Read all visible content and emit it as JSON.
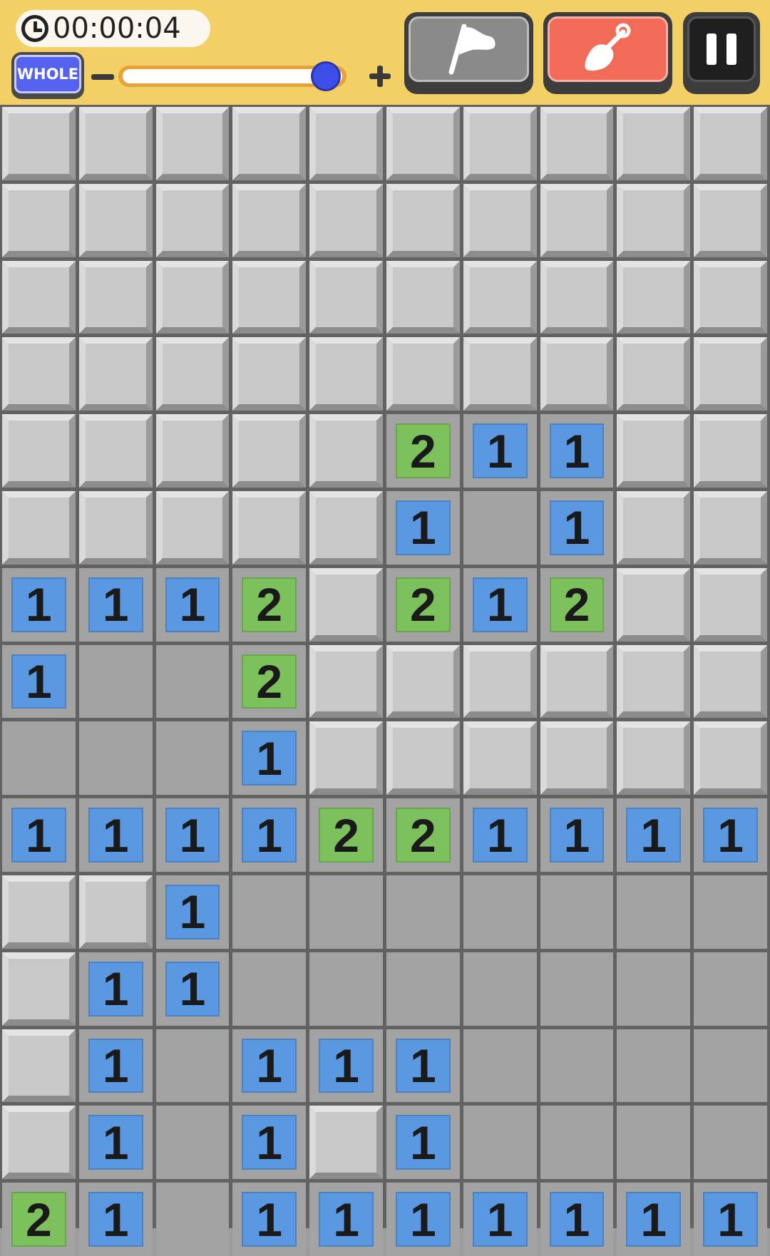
{
  "header": {
    "timer": "00:00:04",
    "zoom_mode_label": "WHOLE",
    "zoom_level": 1.0,
    "tools": {
      "flag": "flag-icon",
      "dig": "shovel-icon",
      "pause": "pause-icon"
    },
    "active_tool": "dig"
  },
  "colors": {
    "header_bg": "#f2d066",
    "one_tile": "#5b98e2",
    "two_tile": "#7cc15c",
    "dig_button": "#f26a58",
    "zoom_mode_button": "#5562f0"
  },
  "board": {
    "columns": 10,
    "legend": "C = covered, R = revealed empty, digits = revealed number",
    "rows": [
      [
        "C",
        "C",
        "C",
        "C",
        "C",
        "C",
        "C",
        "C",
        "C",
        "C"
      ],
      [
        "C",
        "C",
        "C",
        "C",
        "C",
        "C",
        "C",
        "C",
        "C",
        "C"
      ],
      [
        "C",
        "C",
        "C",
        "C",
        "C",
        "C",
        "C",
        "C",
        "C",
        "C"
      ],
      [
        "C",
        "C",
        "C",
        "C",
        "C",
        "C",
        "C",
        "C",
        "C",
        "C"
      ],
      [
        "C",
        "C",
        "C",
        "C",
        "C",
        "2",
        "1",
        "1",
        "C",
        "C"
      ],
      [
        "C",
        "C",
        "C",
        "C",
        "C",
        "1",
        "R",
        "1",
        "C",
        "C"
      ],
      [
        "1",
        "1",
        "1",
        "2",
        "C",
        "2",
        "1",
        "2",
        "C",
        "C"
      ],
      [
        "1",
        "R",
        "R",
        "2",
        "C",
        "C",
        "C",
        "C",
        "C",
        "C"
      ],
      [
        "R",
        "R",
        "R",
        "1",
        "C",
        "C",
        "C",
        "C",
        "C",
        "C"
      ],
      [
        "1",
        "1",
        "1",
        "1",
        "2",
        "2",
        "1",
        "1",
        "1",
        "1"
      ],
      [
        "C",
        "C",
        "1",
        "R",
        "R",
        "R",
        "R",
        "R",
        "R",
        "R"
      ],
      [
        "C",
        "1",
        "1",
        "R",
        "R",
        "R",
        "R",
        "R",
        "R",
        "R"
      ],
      [
        "C",
        "1",
        "R",
        "1",
        "1",
        "1",
        "R",
        "R",
        "R",
        "R"
      ],
      [
        "C",
        "1",
        "R",
        "1",
        "C",
        "1",
        "R",
        "R",
        "R",
        "R"
      ],
      [
        "2",
        "1",
        "R",
        "1",
        "1",
        "1",
        "1",
        "1",
        "1",
        "1"
      ]
    ]
  }
}
